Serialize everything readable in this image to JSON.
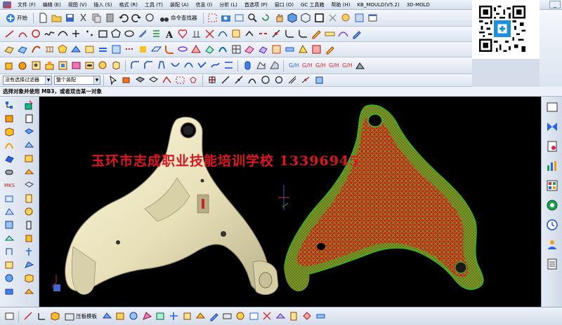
{
  "menu": {
    "items": [
      "文件 (F)",
      "编辑 (E)",
      "视图 (V)",
      "插入 (S)",
      "格式 (R)",
      "工具 (T)",
      "装配 (A)",
      "信息 (I)",
      "分析 (L)",
      "首选项 (P)",
      "窗口 (O)",
      "GC 工具箱",
      "帮助 (H)",
      "KB_MOULD(V5.2)",
      "3D-MOLD"
    ]
  },
  "toolbar": {
    "start_label": "开始",
    "command_finder_label": "命令查找器"
  },
  "selection": {
    "filter_value": "没有选择过滤器",
    "scope_value": "整个装配"
  },
  "status": {
    "message": "选择对象并使用 MB3，或者双击某一对象"
  },
  "viewport": {
    "watermark": "玉环市志成职业技能培训学校  13396945"
  },
  "side_icons": {
    "left_label": "MKS"
  },
  "bottom": {
    "icon_label": "压板模板"
  },
  "colors": {
    "viewport_bg": "#000000",
    "part_fill": "#e9e3bf",
    "mesh_red": "#e0201c",
    "mesh_green": "#39d12b",
    "watermark": "#e0141e",
    "chrome": "#d4dde9"
  }
}
